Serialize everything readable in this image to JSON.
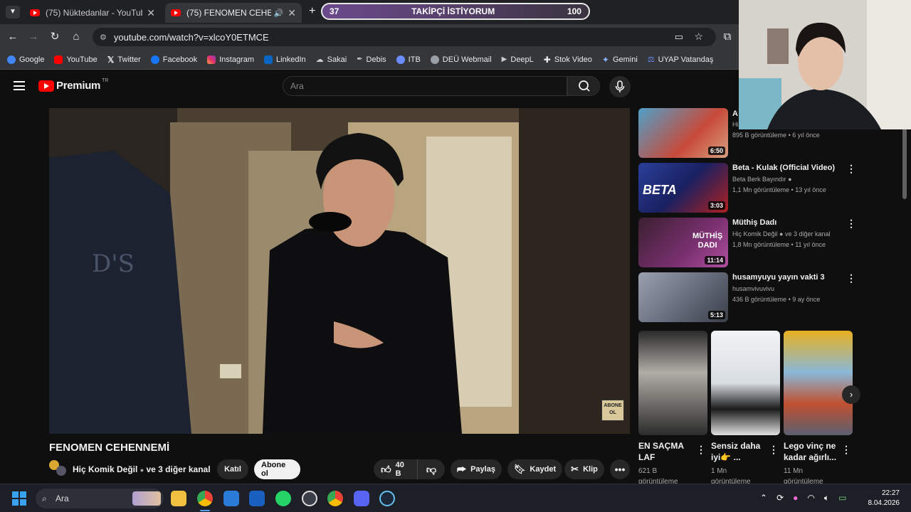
{
  "browser": {
    "tabs": [
      {
        "title": "(75) Nüktedanlar - YouTube",
        "active": false
      },
      {
        "title": "(75) FENOMEN CEHENNEMİ",
        "active": true
      }
    ],
    "url": "youtube.com/watch?v=xlcoY0ETMCE",
    "bookmarks": [
      {
        "label": "Google",
        "icon": "google-icon",
        "color": "#4285f4"
      },
      {
        "label": "YouTube",
        "icon": "youtube-icon",
        "color": "#ff0000"
      },
      {
        "label": "Twitter",
        "icon": "x-icon",
        "color": "#ffffff"
      },
      {
        "label": "Facebook",
        "icon": "facebook-icon",
        "color": "#1877f2"
      },
      {
        "label": "Instagram",
        "icon": "instagram-icon",
        "color": "#e1306c"
      },
      {
        "label": "LinkedIn",
        "icon": "linkedin-icon",
        "color": "#0a66c2"
      },
      {
        "label": "Sakai",
        "icon": "sakai-icon",
        "color": "#c8c8c8"
      },
      {
        "label": "Debis",
        "icon": "debis-icon",
        "color": "#c8c8c8"
      },
      {
        "label": "ITB",
        "icon": "itb-icon",
        "color": "#6b8cff"
      },
      {
        "label": "DEÜ Webmail",
        "icon": "webmail-icon",
        "color": "#c8c8c8"
      },
      {
        "label": "DeepL",
        "icon": "deepl-icon",
        "color": "#c8c8c8"
      },
      {
        "label": "Stok Video",
        "icon": "stock-video-icon",
        "color": "#ffffff"
      },
      {
        "label": "Gemini",
        "icon": "gemini-icon",
        "color": "#8ab4f8"
      },
      {
        "label": "UYAP Vatandaş",
        "icon": "uyap-icon",
        "color": "#6b8cff"
      }
    ]
  },
  "goal_overlay": {
    "current": "37",
    "label": "TAKİPÇİ İSTİYORUM",
    "target": "100",
    "progress": 0.37
  },
  "youtube": {
    "logo_text": "Premium",
    "logo_badge": "TR",
    "search_placeholder": "Ara",
    "player_badge": "ABONE OL",
    "video": {
      "title": "FENOMEN CEHENNEMİ",
      "channel": "Hiç Komik Değil",
      "collab": "ve 3 diğer kanal",
      "join_label": "Katıl",
      "subscribe_label": "Abone ol",
      "likes": "40 B",
      "share_label": "Paylaş",
      "save_label": "Kaydet",
      "clip_label": "Klip"
    },
    "recommendations": [
      {
        "title": "Ay",
        "channel": "Hi",
        "views": "895 B görüntüleme",
        "age": "6 yıl önce",
        "duration": "6:50",
        "thumb_color": "#4fa0c8"
      },
      {
        "title": "Beta - Kulak (Official Video)",
        "channel": "Beta Berk Bayındır",
        "views": "1,1 Mn görüntüleme",
        "age": "13 yıl önce",
        "duration": "3:03",
        "thumb_color": "#2a3f9a"
      },
      {
        "title": "Müthiş Dadı",
        "channel": "Hiç Komik Değil",
        "collab": "ve 3 diğer kanal",
        "views": "1,8 Mn görüntüleme",
        "age": "11 yıl önce",
        "duration": "11:14",
        "thumb_color": "#7a3070"
      },
      {
        "title": "husamyuyu yayın vakti 3",
        "channel": "husamvivuvivu",
        "views": "436 B görüntüleme",
        "age": "9 ay önce",
        "duration": "5:13",
        "thumb_color": "#6a7080"
      }
    ],
    "shorts": [
      {
        "title": "EN SAÇMA LAF",
        "views": "621 B",
        "views_suffix": "görüntüleme",
        "thumb_color": "#8a8a88"
      },
      {
        "title": "Sensiz daha iyi👉 ...",
        "views": "1 Mn",
        "views_suffix": "görüntüleme",
        "thumb_color": "#d8dde2"
      },
      {
        "title": "Lego vinç ne kadar ağırlı...",
        "views": "11 Mn",
        "views_suffix": "görüntüleme",
        "thumb_color": "#8ab8d8"
      }
    ]
  },
  "taskbar": {
    "search_placeholder": "Ara",
    "time": "22:27",
    "date": "8.04.2026"
  }
}
